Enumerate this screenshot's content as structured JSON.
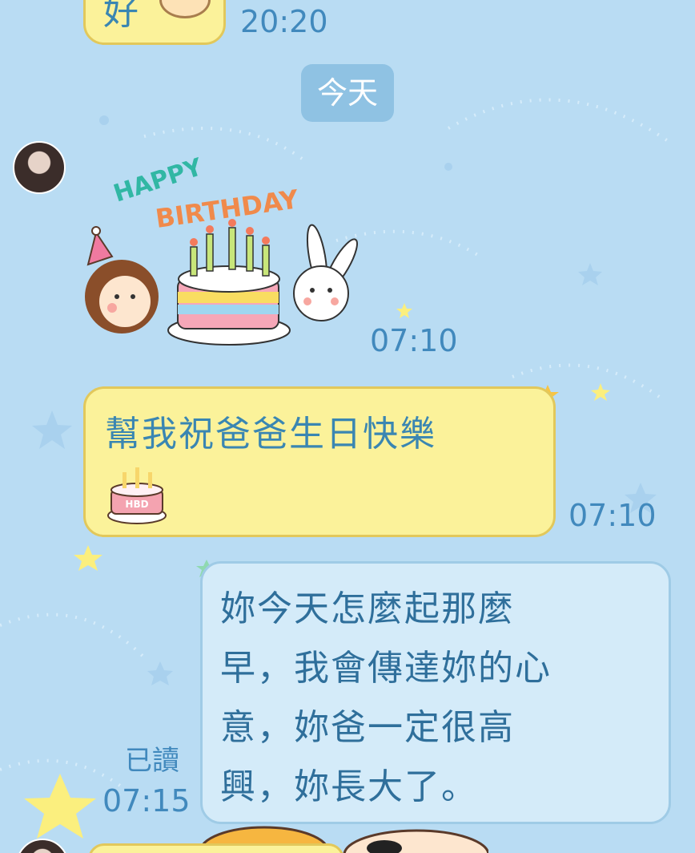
{
  "messages": {
    "prev_in_text": "好",
    "prev_in_time": "20:20",
    "date_divider": "今天",
    "sticker_time": "07:10",
    "in_text": "幫我祝爸爸生日快樂",
    "in_time": "07:10",
    "out_lines": [
      "妳今天怎麼起那麼",
      "早，我會傳達妳的心",
      "意，妳爸一定很高",
      "興，妳長大了。"
    ],
    "out_read": "已讀",
    "out_time": "07:15"
  },
  "sticker": {
    "line1": "HAPPY",
    "line2": "BIRTHDAY"
  },
  "cake_emoji": {
    "label": "HBD"
  },
  "colors": {
    "background": "#b9dcf3",
    "incoming_bubble": "#fbf29a",
    "outgoing_bubble": "#d4ebf9",
    "timestamp": "#4189bd"
  }
}
